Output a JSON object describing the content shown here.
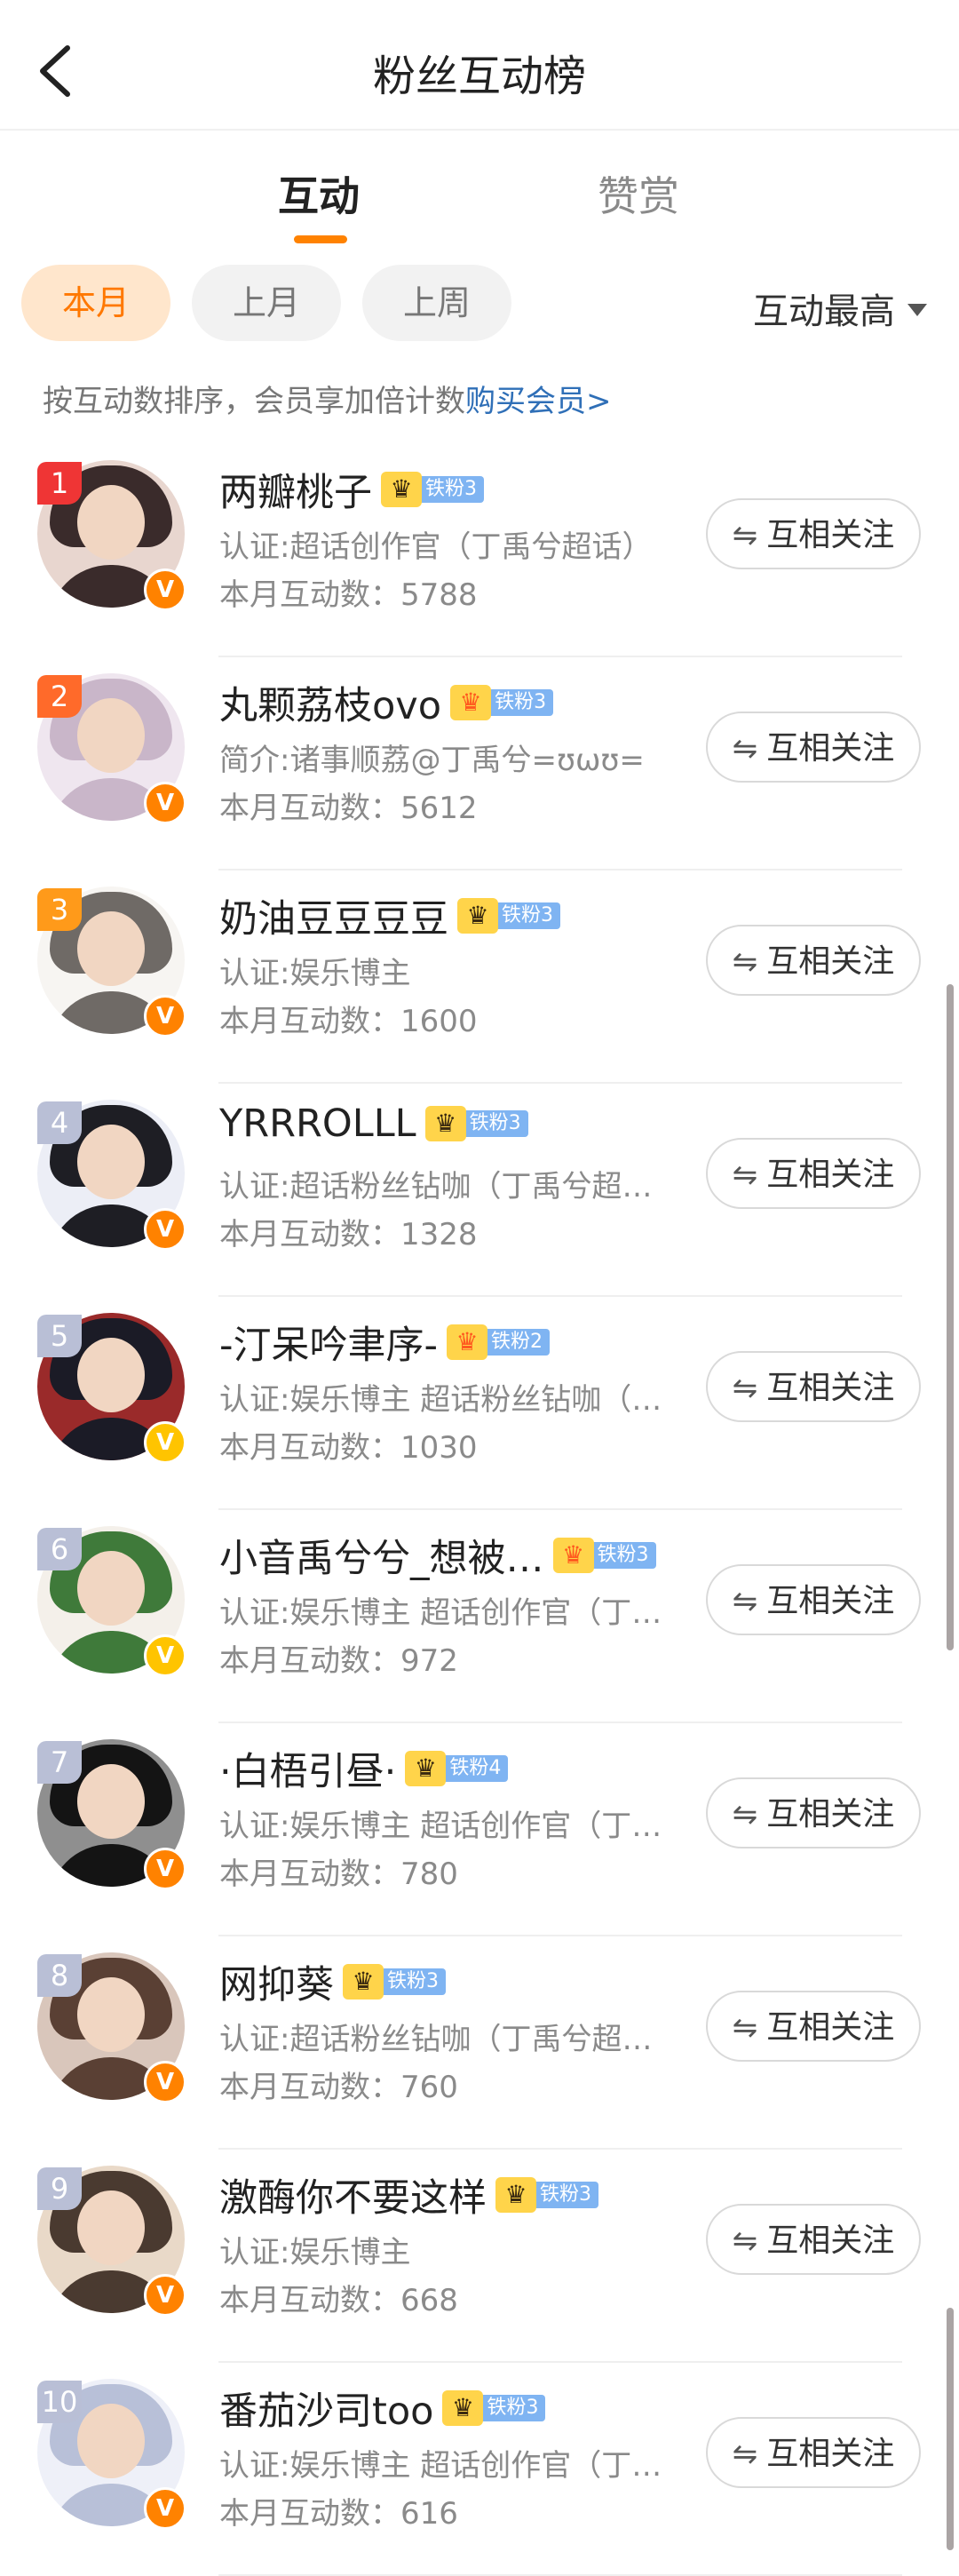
{
  "header": {
    "title": "粉丝互动榜"
  },
  "tabs": [
    {
      "label": "互动"
    },
    {
      "label": "赞赏"
    }
  ],
  "periods": [
    {
      "label": "本月"
    },
    {
      "label": "上月"
    },
    {
      "label": "上周"
    }
  ],
  "sort": {
    "label": "互动最高"
  },
  "notice": {
    "text": "按互动数排序，会员享加倍计数",
    "link": "购买会员>"
  },
  "follow_label": "互相关注",
  "users": [
    {
      "rank": "1",
      "name": "两瓣桃子",
      "badge": "铁粉3",
      "desc": "认证:超话创作官（丁禹兮超话）",
      "count": "本月互动数：5788",
      "rank_color": "#ef3535",
      "v_color": "#ff8200",
      "avatar_colors": [
        "#3a2b2b",
        "#e8d6cf"
      ]
    },
    {
      "rank": "2",
      "name": "丸颗荔枝ovo",
      "badge": "铁粉3",
      "desc": "简介:诸事顺荔@丁禹兮=ʊωʊ=",
      "count": "本月互动数：5612",
      "rank_color": "#ff6a2a",
      "v_color": "#ff8200",
      "avatar_colors": [
        "#c9b6c9",
        "#efe6ef"
      ]
    },
    {
      "rank": "3",
      "name": "奶油豆豆豆豆",
      "badge": "铁粉3",
      "desc": "认证:娱乐博主",
      "count": "本月互动数：1600",
      "rank_color": "#ff9a1a",
      "v_color": "#ff8200",
      "avatar_colors": [
        "#6f6a66",
        "#f7f5f2"
      ]
    },
    {
      "rank": "4",
      "name": "YRRROLLL",
      "badge": "铁粉3",
      "desc": "认证:超话粉丝钻咖（丁禹兮超话）",
      "count": "本月互动数：1328",
      "rank_color": "#b9bfd6",
      "v_color": "#ff8200",
      "avatar_colors": [
        "#1e1e24",
        "#eceef6"
      ]
    },
    {
      "rank": "5",
      "name": "-汀呆吟聿序-",
      "badge": "铁粉2",
      "desc": "认证:娱乐博主 超话粉丝钻咖（丁禹兮超话）",
      "count": "本月互动数：1030",
      "rank_color": "#b9bfd6",
      "v_color": "#ffc400",
      "avatar_colors": [
        "#1b1b26",
        "#9a2a2a"
      ]
    },
    {
      "rank": "6",
      "name": "小音禹兮兮_想被…",
      "badge": "铁粉3",
      "desc": "认证:娱乐博主 超话创作官（丁禹兮超话）",
      "count": "本月互动数：972",
      "rank_color": "#b9bfd6",
      "v_color": "#ffc400",
      "avatar_colors": [
        "#3f7a3a",
        "#f4f0ea"
      ]
    },
    {
      "rank": "7",
      "name": "·白梧引昼·",
      "badge": "铁粉4",
      "desc": "认证:娱乐博主 超话创作官（丁禹兮超话）",
      "count": "本月互动数：780",
      "rank_color": "#b9bfd6",
      "v_color": "#ff8200",
      "avatar_colors": [
        "#141414",
        "#8f8f8f"
      ]
    },
    {
      "rank": "8",
      "name": "网抑葵",
      "badge": "铁粉3",
      "desc": "认证:超话粉丝钻咖（丁禹兮超话）",
      "count": "本月互动数：760",
      "rank_color": "#b9bfd6",
      "v_color": "#ff8200",
      "avatar_colors": [
        "#5a4034",
        "#d9c6bb"
      ]
    },
    {
      "rank": "9",
      "name": "激酶你不要这样",
      "badge": "铁粉3",
      "desc": "认证:娱乐博主",
      "count": "本月互动数：668",
      "rank_color": "#b9bfd6",
      "v_color": "#ff8200",
      "avatar_colors": [
        "#4a3a30",
        "#e9d9c8"
      ]
    },
    {
      "rank": "10",
      "name": "番茄沙司too",
      "badge": "铁粉3",
      "desc": "认证:娱乐博主 超话创作官（丁禹兮超话）",
      "count": "本月互动数：616",
      "rank_color": "#b9bfd6",
      "v_color": "#ff8200",
      "avatar_colors": [
        "#b8c0d8",
        "#eef0f8"
      ]
    }
  ]
}
